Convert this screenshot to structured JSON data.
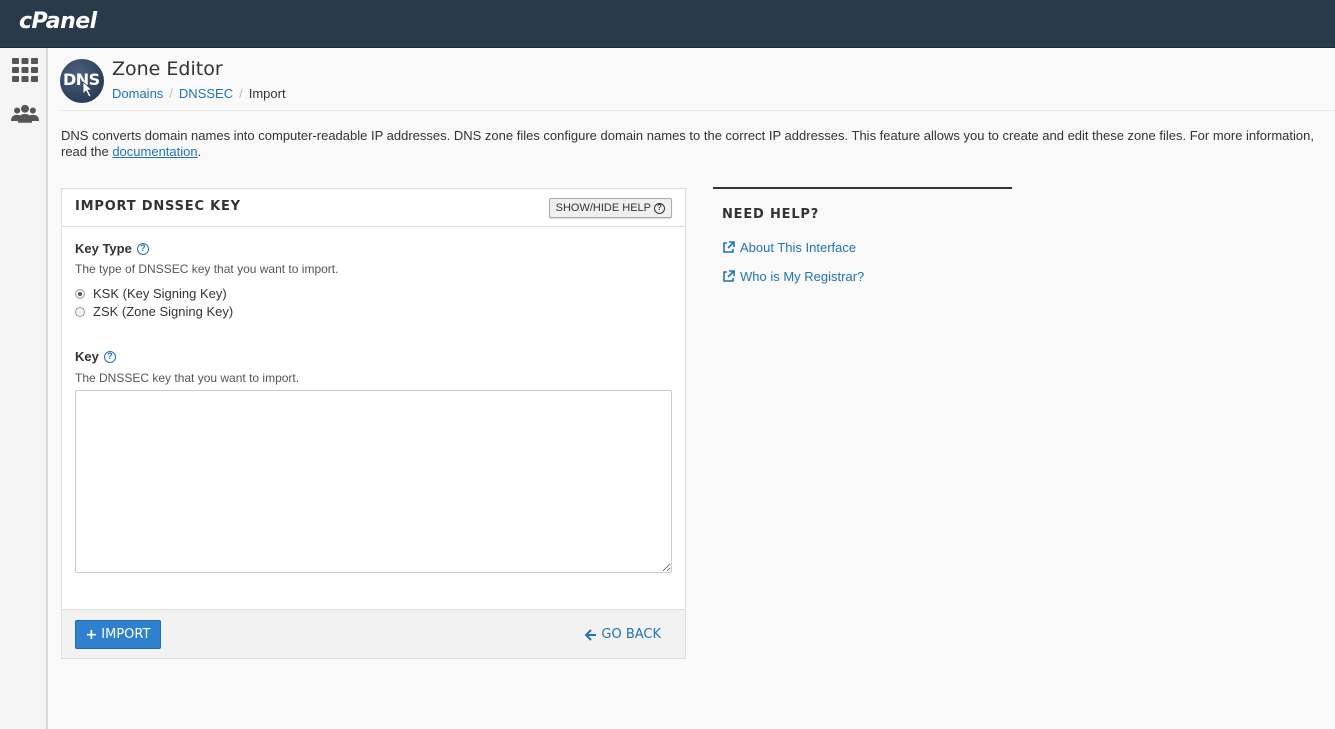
{
  "app": {
    "brand": "cPanel"
  },
  "sidebar": {
    "items": [
      {
        "icon": "grid-icon"
      },
      {
        "icon": "users-icon"
      }
    ]
  },
  "header": {
    "logo_text": "DNS",
    "title": "Zone Editor",
    "breadcrumb": [
      {
        "label": "Domains"
      },
      {
        "label": "DNSSEC"
      },
      {
        "label": "Import"
      }
    ]
  },
  "intro": {
    "text": "DNS converts domain names into computer-readable IP addresses. DNS zone files configure domain names to the correct IP addresses. This feature allows you to create and edit these zone files. For more information, read the ",
    "link": "documentation",
    "suffix": "."
  },
  "form": {
    "title": "IMPORT DNSSEC KEY",
    "help_toggle": "SHOW/HIDE HELP",
    "key_type": {
      "label": "Key Type",
      "description": "The type of DNSSEC key that you want to import.",
      "options": [
        {
          "label": "KSK (Key Signing Key)",
          "selected": true
        },
        {
          "label": "ZSK (Zone Signing Key)",
          "selected": false
        }
      ]
    },
    "key": {
      "label": "Key",
      "description": "The DNSSEC key that you want to import.",
      "value": "",
      "placeholder": ""
    },
    "import_button": "IMPORT",
    "go_back": "GO BACK"
  },
  "help": {
    "title": "NEED HELP?",
    "links": [
      {
        "label": "About This Interface"
      },
      {
        "label": "Who is My Registrar?"
      }
    ]
  },
  "colors": {
    "topbar": "#293a4a",
    "link": "#1f73b7",
    "primary_button": "#2f80cf"
  }
}
